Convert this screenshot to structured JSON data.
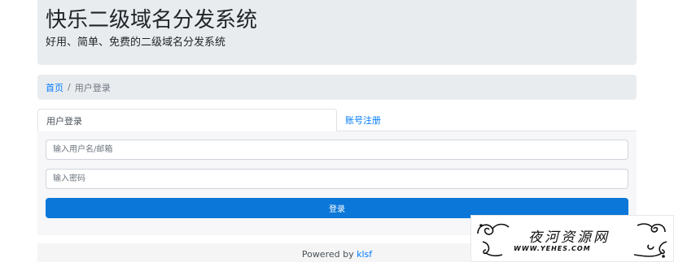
{
  "header": {
    "title": "快乐二级域名分发系统",
    "subtitle": "好用、简单、免费的二级域名分发系统"
  },
  "breadcrumb": {
    "home": "首页",
    "separator": "/",
    "current": "用户登录"
  },
  "tabs": {
    "login": "用户登录",
    "register": "账号注册"
  },
  "form": {
    "username_placeholder": "输入用户名/邮箱",
    "password_placeholder": "输入密码",
    "submit_label": "登录"
  },
  "footer": {
    "powered_prefix": "Powered by",
    "powered_link": "klsf"
  },
  "watermark": {
    "title": "夜河资源网",
    "url": "WWW.YEHES.COM"
  },
  "colors": {
    "accent": "#007bff",
    "button": "#0a77d9",
    "panel": "#e9ecef"
  }
}
